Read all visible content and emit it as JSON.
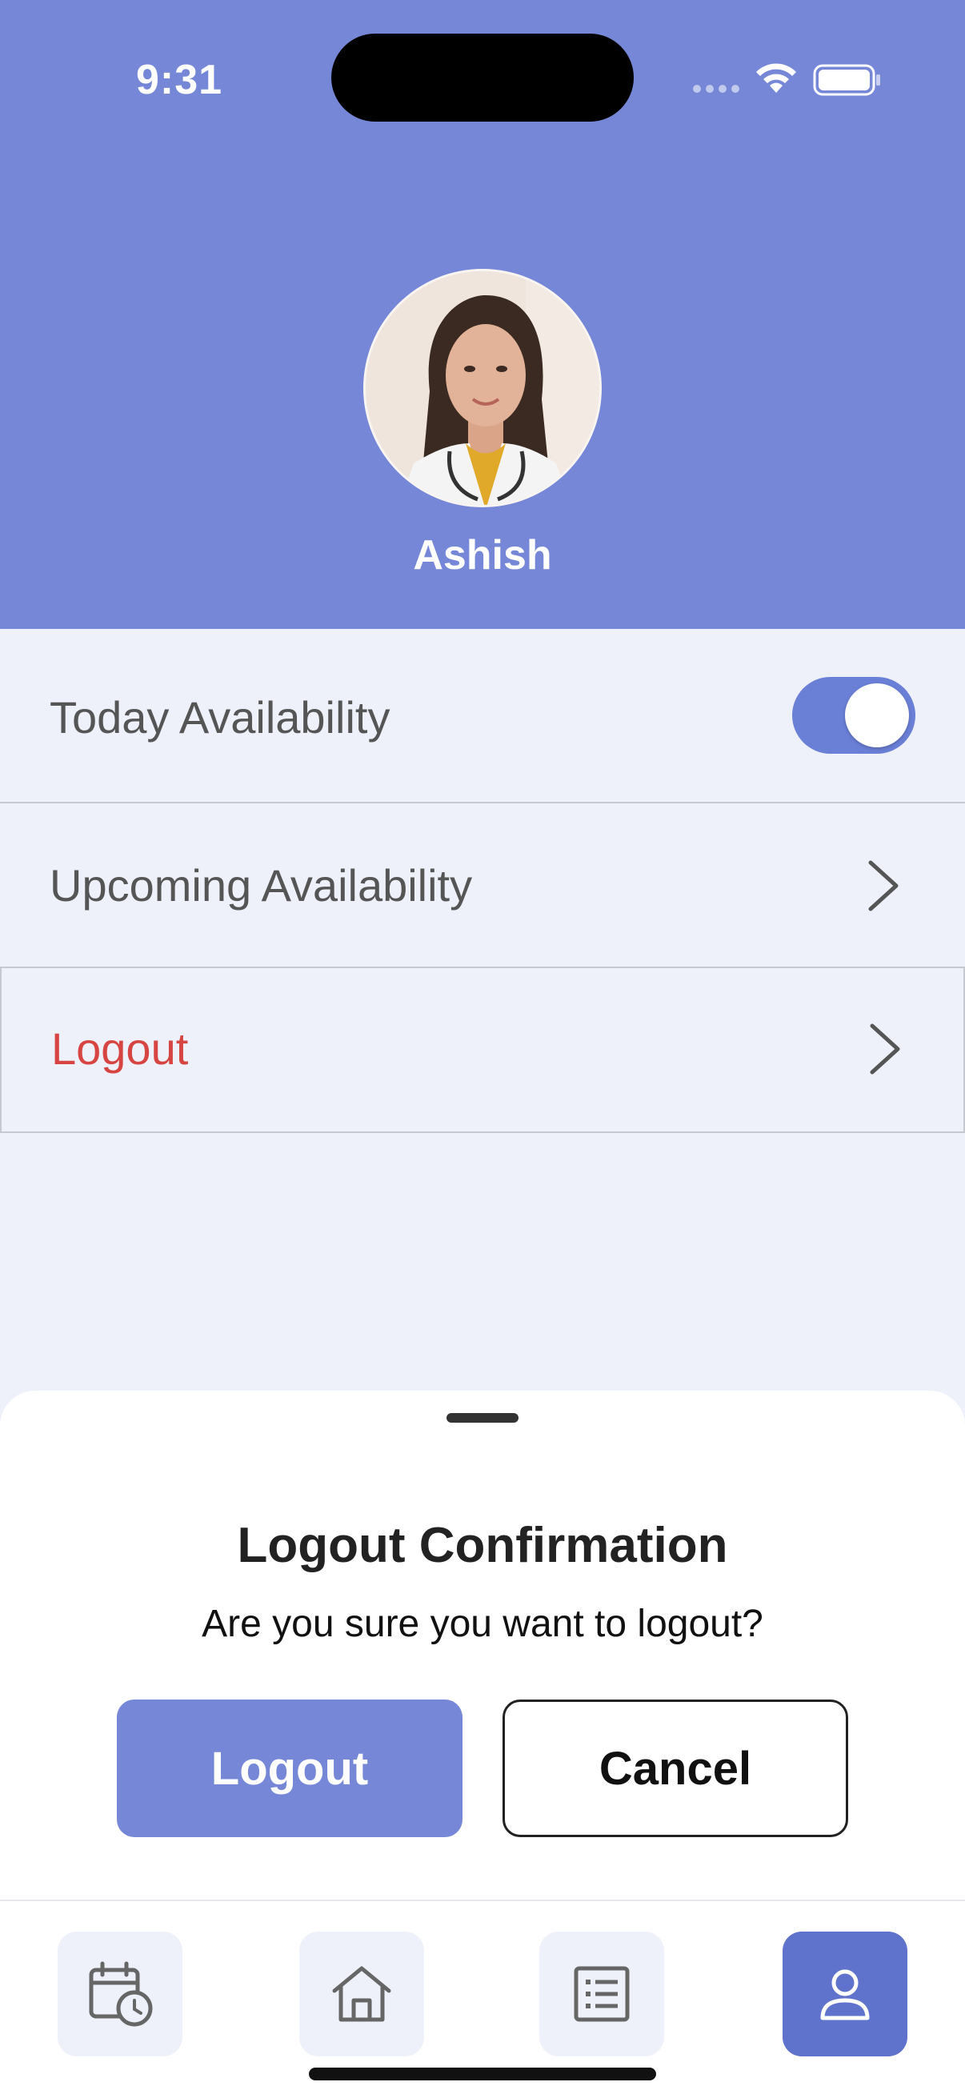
{
  "status_bar": {
    "time": "9:31"
  },
  "profile": {
    "name": "Ashish",
    "avatar": "doctor-avatar-photo"
  },
  "settings": {
    "today_availability": {
      "label": "Today Availability",
      "enabled": true
    },
    "upcoming_availability": {
      "label": "Upcoming Availability"
    },
    "logout": {
      "label": "Logout"
    }
  },
  "dialog": {
    "title": "Logout Confirmation",
    "message": "Are you sure you want to logout?",
    "confirm_label": "Logout",
    "cancel_label": "Cancel"
  },
  "tabbar": {
    "tabs": [
      {
        "icon": "calendar-clock-icon",
        "active": false
      },
      {
        "icon": "home-icon",
        "active": false
      },
      {
        "icon": "list-icon",
        "active": false
      },
      {
        "icon": "person-icon",
        "active": true
      }
    ]
  },
  "colors": {
    "primary": "#7587d6",
    "active_tab": "#6073cc",
    "danger": "#d64541",
    "background": "#eef1f9"
  }
}
